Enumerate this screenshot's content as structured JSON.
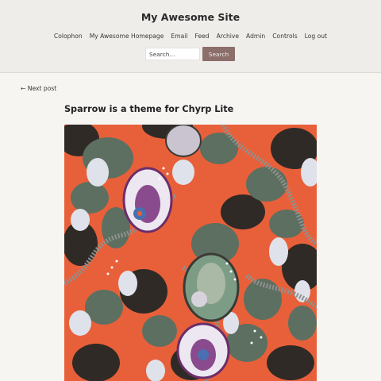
{
  "site": {
    "title": "My Awesome Site"
  },
  "nav": {
    "items": [
      {
        "label": "Colophon",
        "name": "nav-link-colophon"
      },
      {
        "label": "My Awesome Homepage",
        "name": "nav-link-homepage"
      },
      {
        "label": "Email",
        "name": "nav-link-email"
      },
      {
        "label": "Feed",
        "name": "nav-link-feed"
      },
      {
        "label": "Archive",
        "name": "nav-link-archive"
      },
      {
        "label": "Admin",
        "name": "nav-link-admin"
      },
      {
        "label": "Controls",
        "name": "nav-link-controls"
      },
      {
        "label": "Log out",
        "name": "nav-link-log-out"
      }
    ]
  },
  "search": {
    "placeholder": "Search...",
    "button_label": "Search"
  },
  "post": {
    "next_label": "← Next post",
    "title": "Sparrow is a theme for Chyrp Lite"
  },
  "colors": {
    "header_bg": "#efedea",
    "page_bg": "#f7f5f2",
    "accent": "#8c6e6a",
    "image_orange": "#e8603a"
  }
}
